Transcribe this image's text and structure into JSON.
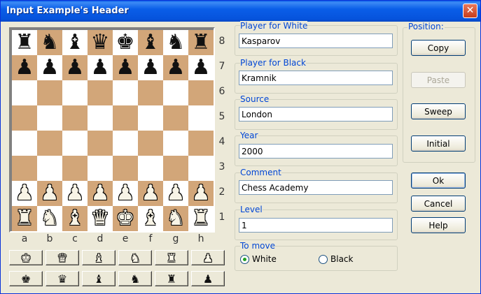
{
  "window": {
    "title": "Input Example's Header",
    "close_label": "✕"
  },
  "board": {
    "ranks": [
      "8",
      "7",
      "6",
      "5",
      "4",
      "3",
      "2",
      "1"
    ],
    "files": [
      "a",
      "b",
      "c",
      "d",
      "e",
      "f",
      "g",
      "h"
    ],
    "rows": [
      [
        "br",
        "bn",
        "bb",
        "bq",
        "bk",
        "bb",
        "bn",
        "br"
      ],
      [
        "bp",
        "bp",
        "bp",
        "bp",
        "bp",
        "bp",
        "bp",
        "bp"
      ],
      [
        "",
        "",
        "",
        "",
        "",
        "",
        "",
        ""
      ],
      [
        "",
        "",
        "",
        "",
        "",
        "",
        "",
        ""
      ],
      [
        "",
        "",
        "",
        "",
        "",
        "",
        "",
        ""
      ],
      [
        "",
        "",
        "",
        "",
        "",
        "",
        "",
        ""
      ],
      [
        "wp",
        "wp",
        "wp",
        "wp",
        "wp",
        "wp",
        "wp",
        "wp"
      ],
      [
        "wr",
        "wn",
        "wb",
        "wq",
        "wk",
        "wb",
        "wn",
        "wr"
      ]
    ],
    "light_color": "#ffffff",
    "dark_color": "#d2a679"
  },
  "palette": {
    "white": [
      "wk",
      "wq",
      "wb",
      "wn",
      "wr",
      "wp"
    ],
    "black": [
      "bk",
      "bq",
      "bb",
      "bn",
      "br",
      "bp"
    ]
  },
  "fields": {
    "white_player": {
      "label": "Player for White",
      "value": "Kasparov"
    },
    "black_player": {
      "label": "Player for Black",
      "value": "Kramnik"
    },
    "source": {
      "label": "Source",
      "value": "London"
    },
    "year": {
      "label": "Year",
      "value": "2000"
    },
    "comment": {
      "label": "Comment",
      "value": "Chess Academy"
    },
    "level": {
      "label": "Level",
      "value": "1"
    }
  },
  "to_move": {
    "label": "To move",
    "white": "White",
    "black": "Black",
    "selected": "White"
  },
  "position": {
    "label": "Position:",
    "copy": "Copy",
    "paste": "Paste",
    "sweep": "Sweep",
    "initial": "Initial"
  },
  "actions": {
    "ok": "Ok",
    "cancel": "Cancel",
    "help": "Help"
  }
}
